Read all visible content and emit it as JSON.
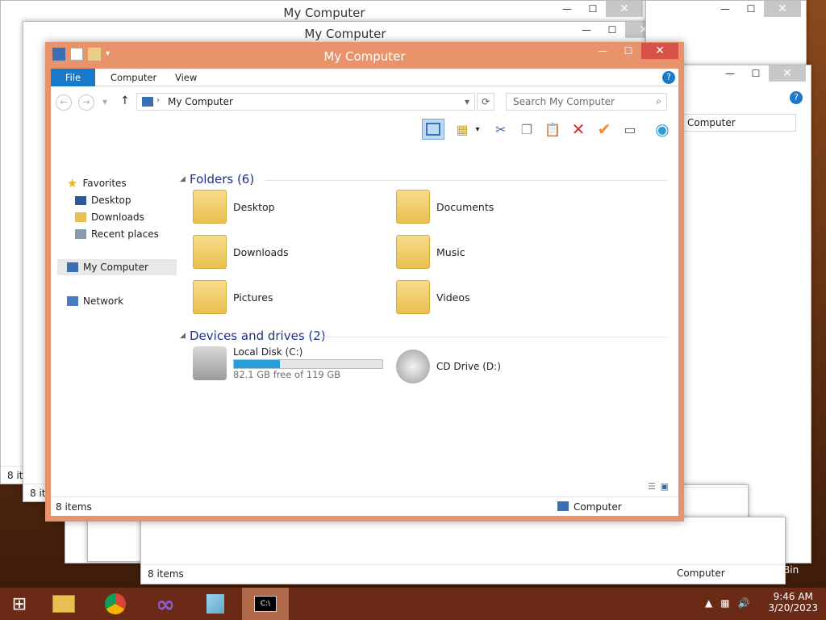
{
  "window": {
    "title": "My Computer",
    "ribbon": {
      "file": "File",
      "computer": "Computer",
      "view": "View",
      "help": "?"
    },
    "address": "My Computer",
    "search_placeholder": "Search My Computer",
    "nav": {
      "favorites": "Favorites",
      "desktop": "Desktop",
      "downloads": "Downloads",
      "recent": "Recent places",
      "mycomputer": "My Computer",
      "network": "Network"
    },
    "folders_header": "Folders (6)",
    "folders": [
      "Desktop",
      "Documents",
      "Downloads",
      "Music",
      "Pictures",
      "Videos"
    ],
    "devices_header": "Devices and drives (2)",
    "drive_c": {
      "label": "Local Disk (C:)",
      "free": "82.1 GB free of 119 GB",
      "used_fraction": 0.31
    },
    "drive_d": {
      "label": "CD Drive (D:)"
    },
    "status_left": "8 items",
    "status_right": "Computer"
  },
  "bg_windows": {
    "title": "My Computer",
    "status": "8 items",
    "computer": "Computer",
    "recycle": "cle Bin"
  },
  "taskbar": {
    "time": "9:46 AM",
    "date": "3/20/2023"
  }
}
